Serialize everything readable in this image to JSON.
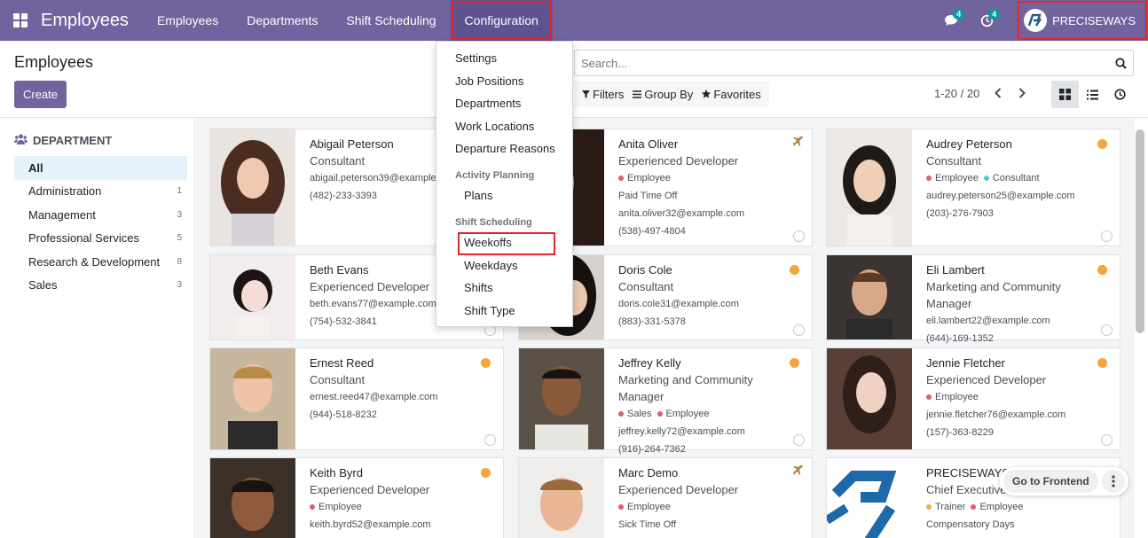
{
  "app": {
    "title": "Employees"
  },
  "nav": {
    "items": [
      "Employees",
      "Departments",
      "Shift Scheduling",
      "Configuration"
    ],
    "messages_badge": "4",
    "activity_badge": "4",
    "user": "PRECISEWAYS"
  },
  "control": {
    "breadcrumb": "Employees",
    "create_label": "Create",
    "search_placeholder": "Search...",
    "filters_label": "Filters",
    "group_by_label": "Group By",
    "favorites_label": "Favorites",
    "pager": "1-20 / 20"
  },
  "dropdown": {
    "items_top": [
      "Settings",
      "Job Positions",
      "Departments",
      "Work Locations",
      "Departure Reasons"
    ],
    "section_activity": "Activity Planning",
    "activity_items": [
      "Plans"
    ],
    "section_shift": "Shift Scheduling",
    "shift_items": [
      "Weekoffs",
      "Weekdays",
      "Shifts",
      "Shift Type"
    ]
  },
  "sidebar": {
    "heading": "DEPARTMENT",
    "items": [
      {
        "label": "All",
        "count": ""
      },
      {
        "label": "Administration",
        "count": "1"
      },
      {
        "label": "Management",
        "count": "3"
      },
      {
        "label": "Professional Services",
        "count": "5"
      },
      {
        "label": "Research & Development",
        "count": "8"
      },
      {
        "label": "Sales",
        "count": "3"
      }
    ]
  },
  "employees": [
    {
      "name": "Abigail Peterson",
      "job": "Consultant",
      "tags": [],
      "lines": [
        "abigail.peterson39@example.com",
        "(482)-233-3393"
      ],
      "status": ""
    },
    {
      "name": "Anita Oliver",
      "job": "Experienced Developer",
      "tags": [
        {
          "label": "Employee",
          "color": "#e05d6f"
        }
      ],
      "lines": [
        "Paid Time Off",
        "anita.oliver32@example.com",
        "(538)-497-4804"
      ],
      "status": "plane"
    },
    {
      "name": "Audrey Peterson",
      "job": "Consultant",
      "tags": [
        {
          "label": "Employee",
          "color": "#e05d6f"
        },
        {
          "label": "Consultant",
          "color": "#5bc0de"
        }
      ],
      "lines": [
        "audrey.peterson25@example.com",
        "(203)-276-7903"
      ],
      "status": "dot"
    },
    {
      "name": "Beth Evans",
      "job": "Experienced Developer",
      "tags": [],
      "lines": [
        "beth.evans77@example.com",
        "(754)-532-3841"
      ],
      "status": ""
    },
    {
      "name": "Doris Cole",
      "job": "Consultant",
      "tags": [],
      "lines": [
        "doris.cole31@example.com",
        "(883)-331-5378"
      ],
      "status": "dot"
    },
    {
      "name": "Eli Lambert",
      "job": "Marketing and Community Manager",
      "tags": [],
      "lines": [
        "eli.lambert22@example.com",
        "(644)-169-1352"
      ],
      "status": "dot"
    },
    {
      "name": "Ernest Reed",
      "job": "Consultant",
      "tags": [],
      "lines": [
        "ernest.reed47@example.com",
        "(944)-518-8232"
      ],
      "status": "dot"
    },
    {
      "name": "Jeffrey Kelly",
      "job": "Marketing and Community Manager",
      "tags": [
        {
          "label": "Sales",
          "color": "#e05d6f"
        },
        {
          "label": "Employee",
          "color": "#e05d6f"
        }
      ],
      "lines": [
        "jeffrey.kelly72@example.com",
        "(916)-264-7362"
      ],
      "status": "dot"
    },
    {
      "name": "Jennie Fletcher",
      "job": "Experienced Developer",
      "tags": [
        {
          "label": "Employee",
          "color": "#e05d6f"
        }
      ],
      "lines": [
        "jennie.fletcher76@example.com",
        "(157)-363-8229"
      ],
      "status": "dot"
    },
    {
      "name": "Keith Byrd",
      "job": "Experienced Developer",
      "tags": [
        {
          "label": "Employee",
          "color": "#e05d6f"
        }
      ],
      "lines": [
        "keith.byrd52@example.com"
      ],
      "status": "dot"
    },
    {
      "name": "Marc Demo",
      "job": "Experienced Developer",
      "tags": [
        {
          "label": "Employee",
          "color": "#e05d6f"
        }
      ],
      "lines": [
        "Sick Time Off"
      ],
      "status": "plane"
    },
    {
      "name": "PRECISEWAYS",
      "job": "Chief Executive",
      "tags": [
        {
          "label": "Trainer",
          "color": "#f0ad4e"
        },
        {
          "label": "Employee",
          "color": "#e05d6f"
        }
      ],
      "lines": [
        "Compensatory Days"
      ],
      "status": ""
    }
  ],
  "fab": {
    "label": "Go to Frontend"
  },
  "colors": {
    "brand": "#71639e",
    "status_away": "#f3a73b",
    "highlight": "#e3262c"
  }
}
